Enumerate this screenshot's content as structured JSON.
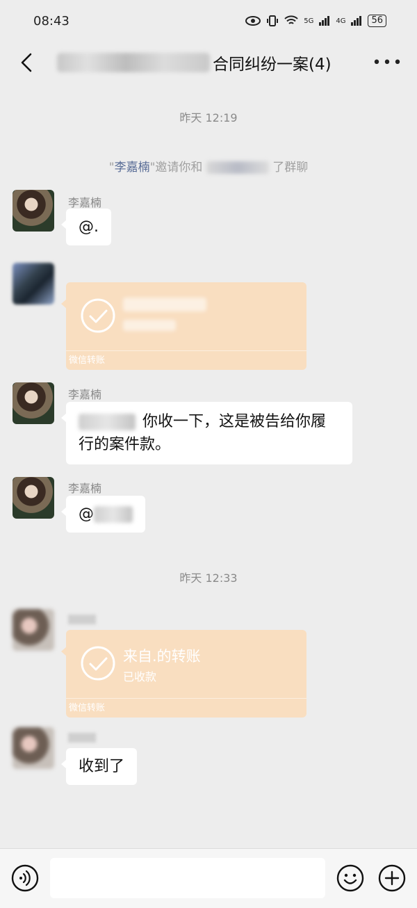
{
  "status_bar": {
    "time": "08:43",
    "network_1": "5G",
    "network_2": "4G",
    "battery": "56"
  },
  "header": {
    "title": "合同纠纷一案(4)"
  },
  "timestamps": [
    "昨天 12:19",
    "昨天 12:33"
  ],
  "system_message": {
    "quote_open": "\"",
    "inviter": "李嘉楠",
    "text_a": "\"邀请你和",
    "text_b": "了群聊"
  },
  "messages": [
    {
      "sender": "李嘉楠",
      "text": "@."
    },
    {
      "sender": "李嘉楠",
      "text": "你收一下，这是被告给你履行的案件款。"
    },
    {
      "sender": "李嘉楠",
      "text": "@"
    },
    {
      "text": "收到了"
    }
  ],
  "transfers": [
    {
      "title": "",
      "status": "",
      "footer": "微信转账"
    },
    {
      "title": "来自.的转账",
      "status": "已收款",
      "footer": "微信转账"
    }
  ],
  "input": {
    "placeholder": ""
  },
  "colors": {
    "background": "#ededed",
    "bubble": "#ffffff",
    "transfer": "#f9dec0",
    "link_name": "#576b95"
  },
  "icons": [
    "back-icon",
    "more-icon",
    "check-icon",
    "voice-icon",
    "emoji-icon",
    "plus-icon",
    "eye-icon",
    "vibrate-icon",
    "wifi-icon",
    "signal-icon",
    "battery-icon"
  ]
}
